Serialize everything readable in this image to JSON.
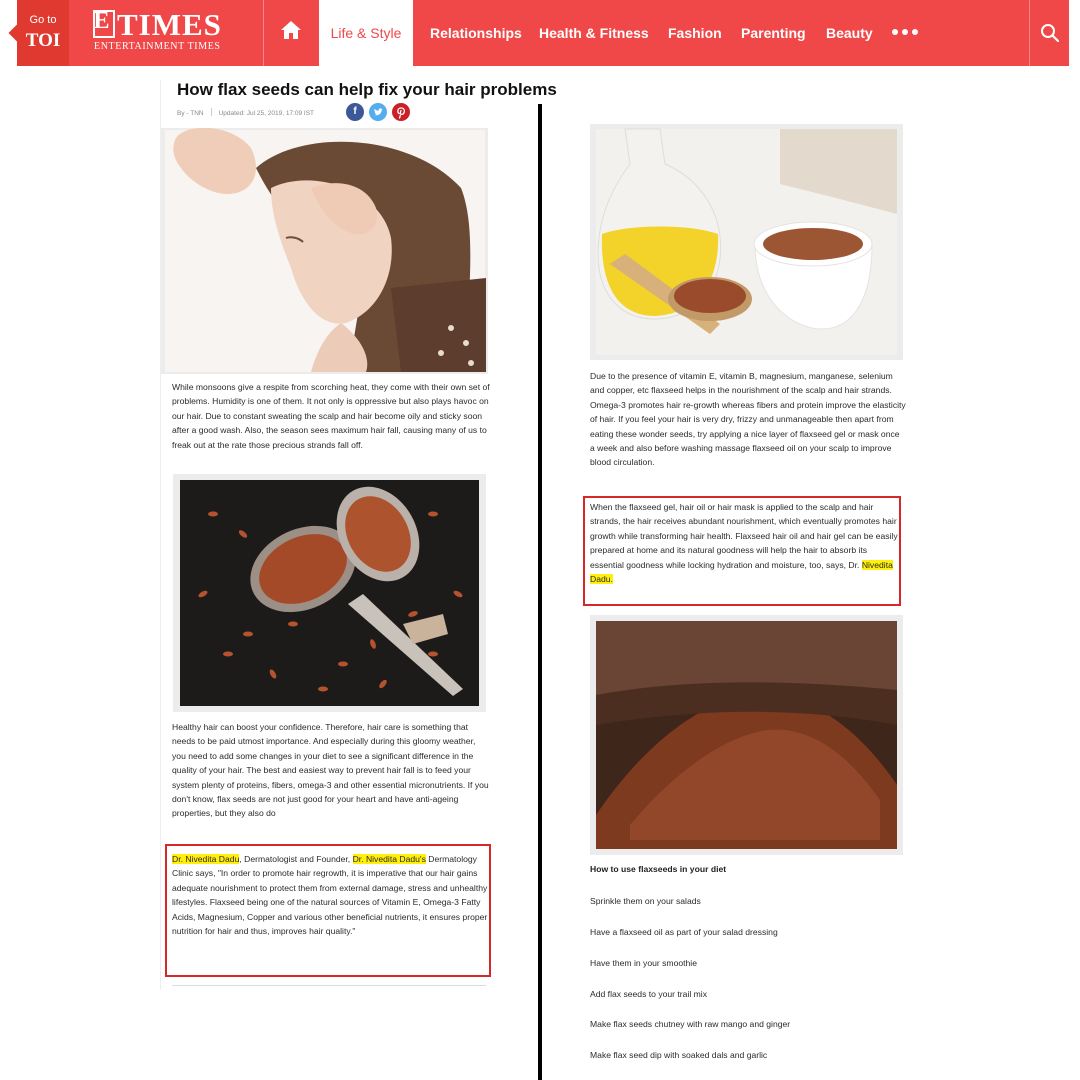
{
  "nav": {
    "goto_small": "Go to",
    "goto_big": "TOI",
    "logo_letter": "E",
    "logo_word": "TIMES",
    "logo_sub": "ENTERTAINMENT TIMES",
    "items": [
      "Life & Style",
      "Relationships",
      "Health & Fitness",
      "Fashion",
      "Parenting",
      "Beauty"
    ],
    "active_item": "Life & Style",
    "brand_color": "#f04848",
    "icons": [
      "home-icon",
      "more-icon",
      "search-icon"
    ]
  },
  "article": {
    "title": "How flax seeds can help fix your hair problems",
    "byline_author": "By - TNN",
    "byline_updated": "Updated: Jul 25, 2019, 17:09 IST",
    "share_icons": [
      "facebook-icon",
      "twitter-icon",
      "pinterest-icon"
    ],
    "left": {
      "para1": "While monsoons give a respite from scorching heat, they come with their own set of problems. Humidity is one of them. It not only is oppressive but also plays havoc on our hair. Due to constant sweating the scalp and hair become oily and sticky soon after a good wash. Also, the season sees maximum hair fall, causing many of us to freak out at the rate those precious strands fall off.",
      "para2": "Healthy hair can boost your confidence. Therefore, hair care is something that needs to be paid utmost importance. And especially during this gloomy weather, you need to add some changes in your diet to see a significant difference in the quality of your hair. The best and easiest way to prevent hair fall is to feed your system plenty of proteins, fibers, omega-3 and other essential micronutrients. If you don't know, flax seeds are not just good for your heart and have anti-ageing properties, but they also do",
      "quote_name1": "Dr. Nivedita Dadu",
      "quote_mid": ", Dermatologist and Founder, ",
      "quote_name2": "Dr. Nivedita Dadu's",
      "quote_rest": " Dermatology Clinic says, \"In order to promote hair regrowth, it is imperative that our hair gains adequate nourishment to protect them from external damage, stress and unhealthy lifestyles. Flaxseed being one of the natural sources of Vitamin E, Omega-3 Fatty Acids, Magnesium, Copper and various other beneficial nutrients, it ensures proper nutrition for hair and thus, improves hair quality.\""
    },
    "right": {
      "para1": "Due to the presence of vitamin E, vitamin B, magnesium, manganese, selenium and copper, etc flaxseed helps in the nourishment of the scalp and hair strands. Omega-3 promotes hair re-growth whereas fibers and protein improve the elasticity of hair. If you feel your hair is very dry, frizzy and unmanageable then apart from eating these wonder seeds, try applying a nice layer of flaxseed gel or mask once a week and also before washing massage flaxseed oil on your scalp to improve blood circulation.",
      "quote_text": "When the flaxseed gel, hair oil or hair mask is applied to the scalp and hair strands, the hair receives abundant nourishment, which eventually promotes hair growth while transforming hair health. Flaxseed hair oil and hair gel can be easily prepared at home and its natural goodness will help the hair to absorb its essential goodness while locking hydration and moisture, too, says, Dr. ",
      "quote_name": "Nivedita Dadu.",
      "how_heading": "How to use flaxseeds in your diet",
      "tips": [
        "Sprinkle them on your salads",
        "Have a flaxseed oil as part of your salad dressing",
        "Have them in your smoothie",
        "Add flax seeds to your trail mix",
        "Make flax seeds chutney with raw mango and ginger",
        "Make flax seed dip with soaked dals and garlic"
      ]
    }
  },
  "colors": {
    "highlight": "#ffef0a",
    "callout_border": "#d62828",
    "divider": "#000000"
  }
}
